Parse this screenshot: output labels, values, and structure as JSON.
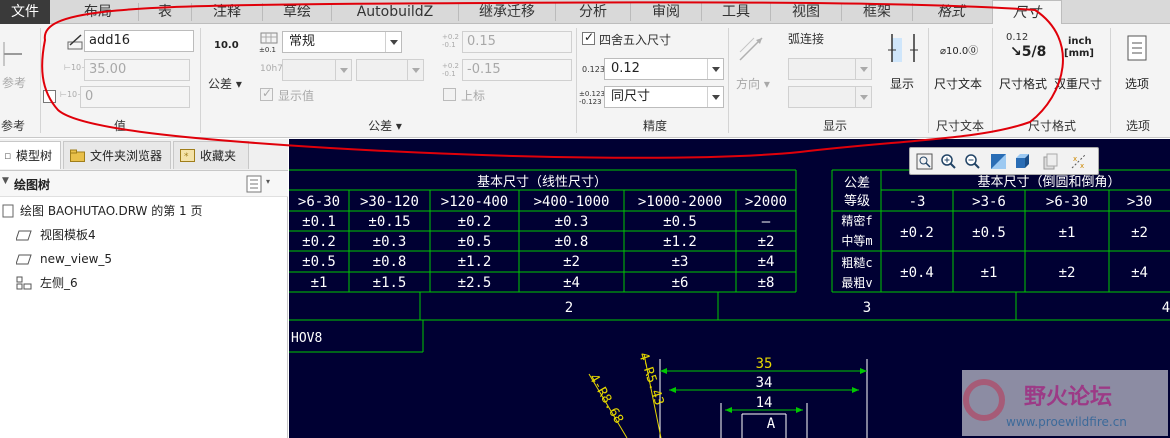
{
  "tabs": [
    "文件",
    "布局",
    "表",
    "注释",
    "草绘",
    "AutobuildZ",
    "继承迁移",
    "分析",
    "审阅",
    "工具",
    "视图",
    "框架",
    "格式",
    "尺寸"
  ],
  "ribbon": {
    "reference_group": {
      "label": "参考",
      "button_label": "参考"
    },
    "value_group": {
      "label": "值",
      "name_value": "add16",
      "nominal_value": "35.00",
      "override_value": "0"
    },
    "tolerance_group": {
      "label": "公差",
      "tol_button_label": "公差",
      "format_icon_text": "10.0",
      "tol_mode_icon_text": "±0.1",
      "tol_mode_value": "常规",
      "fit_icon_text": "10h7",
      "show_value_label": "显示值",
      "upper_value": "0.15",
      "lower_value": "-0.15",
      "superscript_label": "上标"
    },
    "precision_group": {
      "label": "精度",
      "round_label": "四舍五入尺寸",
      "decimal_icon_text": "0.123",
      "decimal_value": "0.12",
      "tol_decimal_icon_text": "±0.123",
      "tol_decimal_value": "同尺寸"
    },
    "display_group": {
      "label": "显示",
      "direction_label": "方向",
      "arc_label": "弧连接",
      "display_button_label": "显示"
    },
    "dim_text_group": {
      "label": "尺寸文本",
      "button_label": "尺寸文本",
      "icon_text": "⌀10.0⓪"
    },
    "dim_format_group": {
      "label": "尺寸格式",
      "format_button_label": "尺寸格式",
      "dual_button_label": "双重尺寸",
      "format_icon_text": "0.12",
      "dual_icon_text_top": "inch",
      "dual_icon_text_bottom": "[mm]"
    },
    "options_group": {
      "label": "选项",
      "button_label": "选项"
    }
  },
  "left_panel": {
    "tabs": [
      "模型树",
      "文件夹浏览器",
      "收藏夹"
    ],
    "tree_header": "绘图树",
    "items": [
      "绘图 BAOHUTAO.DRW 的第 1 页",
      "视图模板4",
      "new_view_5",
      "左侧_6"
    ]
  },
  "drawing": {
    "table_title_left": "基本尺寸（线性尺寸）",
    "table_header_left": [
      ">6-30",
      ">30-120",
      ">120-400",
      ">400-1000",
      ">1000-2000",
      ">2000"
    ],
    "table_rows_left": [
      [
        "±0.1",
        "±0.15",
        "±0.2",
        "±0.3",
        "±0.5",
        "—"
      ],
      [
        "±0.2",
        "±0.3",
        "±0.5",
        "±0.8",
        "±1.2",
        "±2"
      ],
      [
        "±0.5",
        "±0.8",
        "±1.2",
        "±2",
        "±3",
        "±4"
      ],
      [
        "±1",
        "±1.5",
        "±2.5",
        "±4",
        "±6",
        "±8"
      ]
    ],
    "tolerance_class_label": [
      "公差",
      "等级"
    ],
    "class_names": [
      "精密f",
      "中等m",
      "粗糙c",
      "最粗v"
    ],
    "table_title_right": "基本尺寸（倒圆和倒角）",
    "table_header_right": [
      "-3",
      ">3-6",
      ">6-30",
      ">30"
    ],
    "table_rows_right": [
      [
        "±0.2",
        "±0.5",
        "±1",
        "±2"
      ],
      [
        "±0.4",
        "±1",
        "±2",
        "±4"
      ]
    ],
    "zone_numbers": [
      "2",
      "3",
      "4"
    ],
    "label_box_text": "HOV8",
    "dims": [
      "35",
      "34",
      "14",
      "A"
    ],
    "slanted_dims": [
      "4-R5.43",
      "4-R8.68"
    ]
  },
  "watermark": {
    "title": "野火论坛",
    "url": "www.proewildfire.cn"
  },
  "colors": {
    "canvas_bg": "#000033",
    "table_green": "#00c800",
    "table_text": "#ffffff",
    "dim_yellow": "#e6d800",
    "annotation_red": "#e0000a",
    "file_tab": "#3a3a3a"
  }
}
